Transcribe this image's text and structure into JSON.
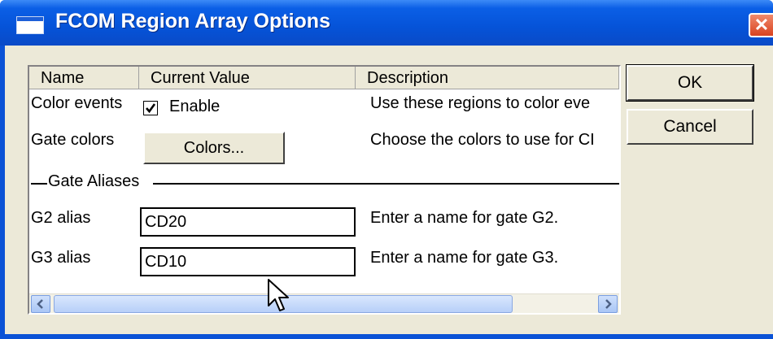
{
  "window": {
    "title": "FCOM Region Array Options",
    "close_glyph": "✕"
  },
  "list": {
    "columns": [
      "Name",
      "Current Value",
      "Description"
    ],
    "rows": {
      "color_events": {
        "name": "Color events",
        "checkbox_checked": true,
        "checkbox_label": "Enable",
        "description": "Use these regions to color eve"
      },
      "gate_colors": {
        "name": "Gate colors",
        "button_label": "Colors...",
        "description": "Choose the colors to use for CI"
      },
      "group": {
        "label": "Gate Aliases"
      },
      "g2_alias": {
        "name": "G2 alias",
        "value": "CD20",
        "description": "Enter a name for gate G2."
      },
      "g3_alias": {
        "name": "G3 alias",
        "value": "CD10",
        "description": "Enter a name for gate G3."
      }
    },
    "horizontal_scroll_position": 0
  },
  "buttons": {
    "ok": "OK",
    "cancel": "Cancel"
  },
  "colors": {
    "titlebar": "#0553d8",
    "dialog_bg": "#ece9d8",
    "close_button": "#d9421f"
  }
}
